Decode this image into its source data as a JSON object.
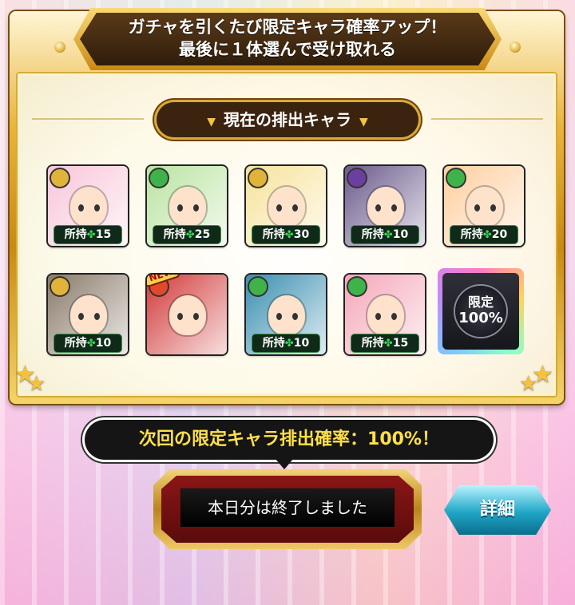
{
  "header": {
    "line1": "ガチャを引くたび限定キャラ確率アップ！",
    "line2": "最後に１体選んで受け取れる"
  },
  "section_title": "現在の排出キャラ",
  "owned_prefix": "所持",
  "characters": [
    {
      "owned": "15",
      "element": "light",
      "color": "#f9c6d9"
    },
    {
      "owned": "25",
      "element": "wood",
      "color": "#b9e3a0"
    },
    {
      "owned": "30",
      "element": "light",
      "color": "#f7e39b"
    },
    {
      "owned": "10",
      "element": "dark",
      "color": "#6b5a8c"
    },
    {
      "owned": "20",
      "element": "wood",
      "color": "#ffcfa0"
    },
    {
      "owned": "10",
      "element": "light",
      "color": "#8a7a6a"
    },
    {
      "owned": "",
      "element": "fire",
      "color": "#d23a3a",
      "new": "NEW"
    },
    {
      "owned": "10",
      "element": "wood",
      "color": "#3a8fb0"
    },
    {
      "owned": "15",
      "element": "wood",
      "color": "#f5a6b8"
    }
  ],
  "limited_card": {
    "line1": "限定",
    "line2": "100%"
  },
  "rate_text": "次回の限定キャラ排出確率：100%！",
  "done_button": "本日分は終了しました",
  "detail_button": "詳細",
  "colors": {
    "gold": "#d9a93a",
    "wood": "#3fb34a",
    "light": "#e0b43a",
    "dark": "#6b3fa0",
    "fire": "#e04a2a"
  }
}
